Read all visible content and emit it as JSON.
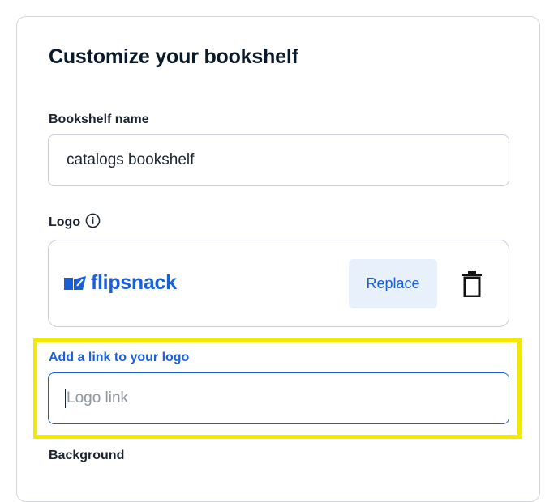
{
  "form": {
    "title": "Customize your bookshelf",
    "name_label": "Bookshelf name",
    "name_value": "catalogs bookshelf",
    "logo_label": "Logo",
    "logo_brand": "flipsnack",
    "replace_label": "Replace",
    "link_label": "Add a link to your logo",
    "link_placeholder": "Logo link",
    "background_label": "Background"
  },
  "colors": {
    "accent": "#1b5fd6",
    "highlight": "#f1ea00",
    "replace_bg": "#e8f0fc"
  },
  "icons": {
    "info": "info-circle-icon",
    "trash": "trash-icon",
    "brand": "flipsnack-logo-icon"
  }
}
